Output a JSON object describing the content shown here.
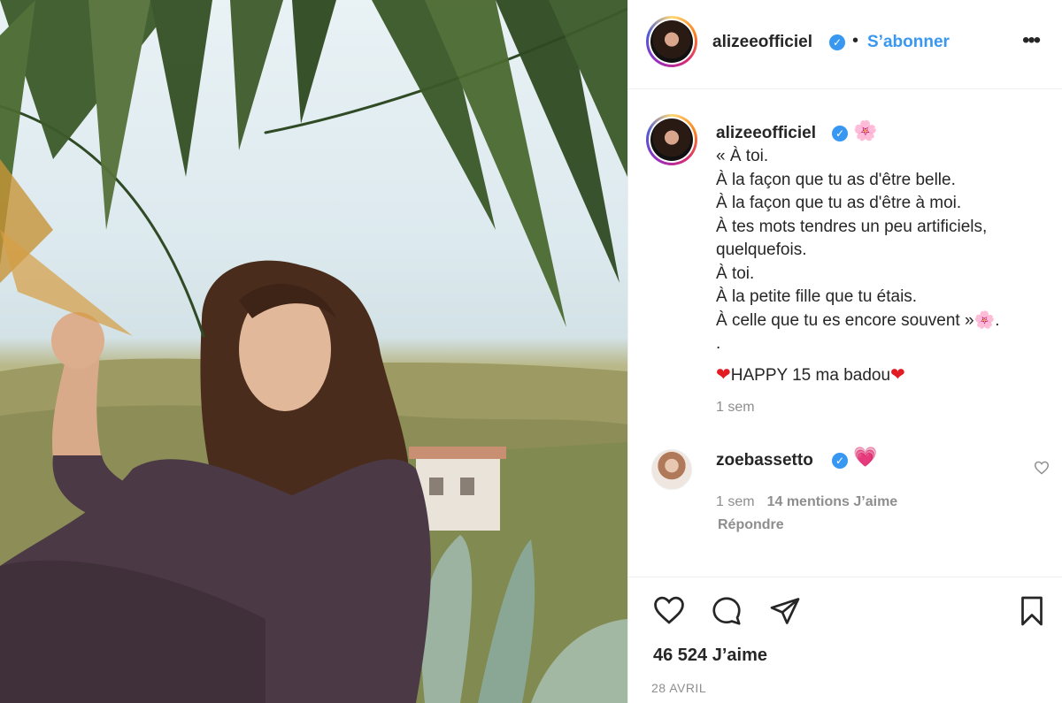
{
  "post": {
    "author": "alizeeofficiel",
    "follow_label": "S’abonner",
    "separator": "•",
    "more_label": "•••",
    "verified_mark": "✓"
  },
  "caption": {
    "author": "alizeeofficiel",
    "title_emoji": "🌸",
    "lines": [
      "« À toi.",
      "À la façon que tu as d'être belle.",
      "À la façon que tu as d'être à moi.",
      "À tes mots tendres un peu artificiels,",
      "quelquefois.",
      "À toi.",
      "À la petite fille que tu étais.",
      "À celle que tu es encore souvent »",
      "."
    ],
    "closing_emoji": "🌸",
    "birthday_heart": "❤",
    "birthday_text": "HAPPY 15 ma badou",
    "time": "1 sem"
  },
  "comment": {
    "author": "zoebassetto",
    "emoji": "💗",
    "time": "1 sem",
    "likes": "14 mentions J’aime",
    "reply_label": "Répondre"
  },
  "footer": {
    "likes": "46 524 J’aime",
    "date": "28 AVRIL"
  },
  "colors": {
    "accent": "#3897f0",
    "text": "#262626",
    "muted": "#8e8e8e",
    "border": "#efefef"
  }
}
